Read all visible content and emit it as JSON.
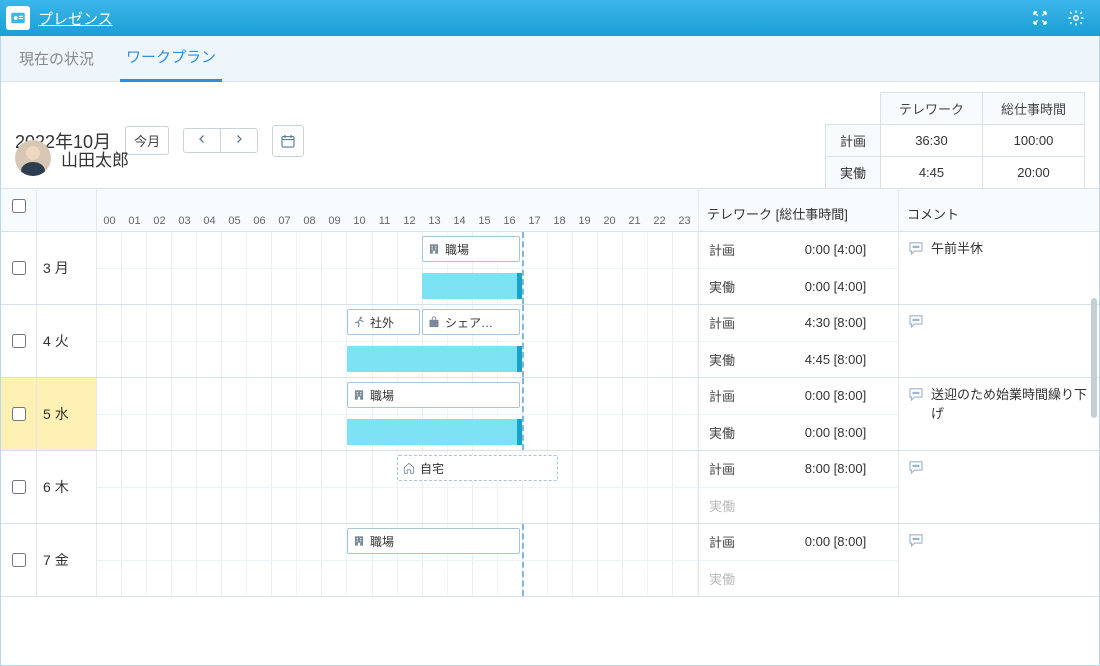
{
  "title": "プレゼンス",
  "tabs": {
    "current": "現在の状況",
    "workplan": "ワークプラン"
  },
  "toolbar": {
    "yearmonth": "2022年10月",
    "today_btn": "今月"
  },
  "summary": {
    "head_tele": "テレワーク",
    "head_total": "総仕事時間",
    "row_plan": "計画",
    "row_actual": "実働",
    "plan_tele": "36:30",
    "plan_total": "100:00",
    "actual_tele": "4:45",
    "actual_total": "20:00"
  },
  "user": {
    "name": "山田太郎"
  },
  "headers": {
    "telework": "テレワーク [総仕事時間]",
    "comment": "コメント",
    "plan": "計画",
    "actual": "実働"
  },
  "hours": [
    "00",
    "01",
    "02",
    "03",
    "04",
    "05",
    "06",
    "07",
    "08",
    "09",
    "10",
    "11",
    "12",
    "13",
    "14",
    "15",
    "16",
    "17",
    "18",
    "19",
    "20",
    "21",
    "22",
    "23"
  ],
  "days": [
    {
      "dnum": "3",
      "dweek": "月",
      "blocks": [
        {
          "label": "職場",
          "icon": "building",
          "start": 13,
          "end": 17,
          "dashed": false
        }
      ],
      "bars": [
        {
          "start": 13,
          "end": 17
        }
      ],
      "dash_at": 17,
      "plan": "0:00 [4:00]",
      "actual": "0:00 [4:00]",
      "comment": "午前半休",
      "has_comment_icon": true
    },
    {
      "dnum": "4",
      "dweek": "火",
      "blocks": [
        {
          "label": "社外",
          "icon": "run",
          "start": 10,
          "end": 13,
          "dashed": false
        },
        {
          "label": "シェア…",
          "icon": "share",
          "start": 13,
          "end": 17,
          "dashed": false
        }
      ],
      "bars": [
        {
          "start": 10,
          "end": 17
        }
      ],
      "dash_at": 17,
      "plan": "4:30 [8:00]",
      "actual": "4:45 [8:00]",
      "comment": "",
      "has_comment_icon": true
    },
    {
      "dnum": "5",
      "dweek": "水",
      "today": true,
      "blocks": [
        {
          "label": "職場",
          "icon": "building",
          "start": 10,
          "end": 17,
          "dashed": false
        }
      ],
      "bars": [
        {
          "start": 10,
          "end": 17
        }
      ],
      "dash_at": 17,
      "plan": "0:00 [8:00]",
      "actual": "0:00 [8:00]",
      "comment": "送迎のため始業時間繰り下げ",
      "has_comment_icon": true
    },
    {
      "dnum": "6",
      "dweek": "木",
      "blocks": [
        {
          "label": "自宅",
          "icon": "home",
          "start": 12,
          "end": 18.5,
          "dashed": true
        }
      ],
      "bars": [],
      "dash_at": null,
      "plan": "8:00 [8:00]",
      "actual": "",
      "actual_muted": true,
      "comment": "",
      "has_comment_icon": true
    },
    {
      "dnum": "7",
      "dweek": "金",
      "blocks": [
        {
          "label": "職場",
          "icon": "building",
          "start": 10,
          "end": 17,
          "dashed": false
        }
      ],
      "bars": [],
      "dash_at": 17,
      "plan": "0:00 [8:00]",
      "actual": "",
      "actual_muted": true,
      "comment": "",
      "has_comment_icon": true
    }
  ]
}
